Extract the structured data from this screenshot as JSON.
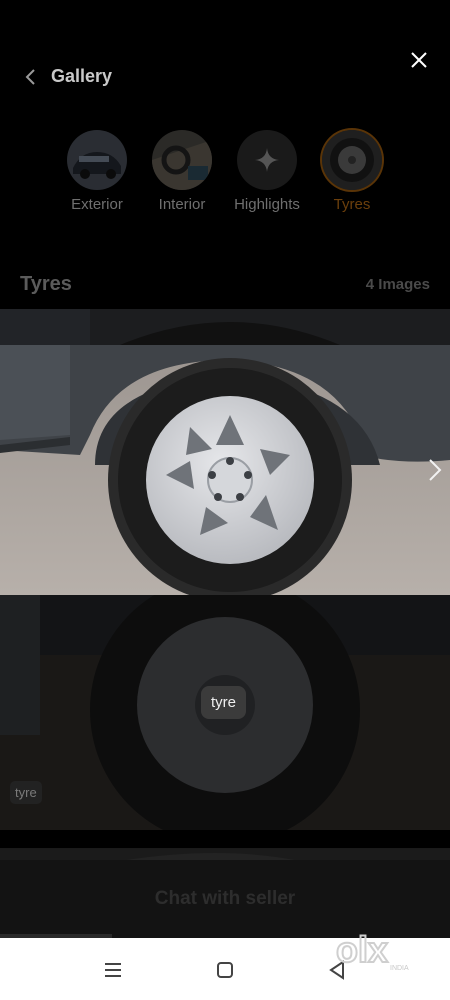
{
  "header": {
    "title": "Gallery"
  },
  "categories": [
    {
      "label": "Exterior"
    },
    {
      "label": "Interior"
    },
    {
      "label": "Highlights"
    },
    {
      "label": "Tyres"
    }
  ],
  "section": {
    "title": "Tyres",
    "count": "4 Images"
  },
  "tags": {
    "center": "tyre",
    "corner": "tyre"
  },
  "footer": {
    "cta": "Chat with seller"
  },
  "brand": {
    "logo_text": "olx",
    "logo_sub": "INDIA"
  },
  "colors": {
    "active_category": "#6b3f0c",
    "background": "#000000"
  }
}
